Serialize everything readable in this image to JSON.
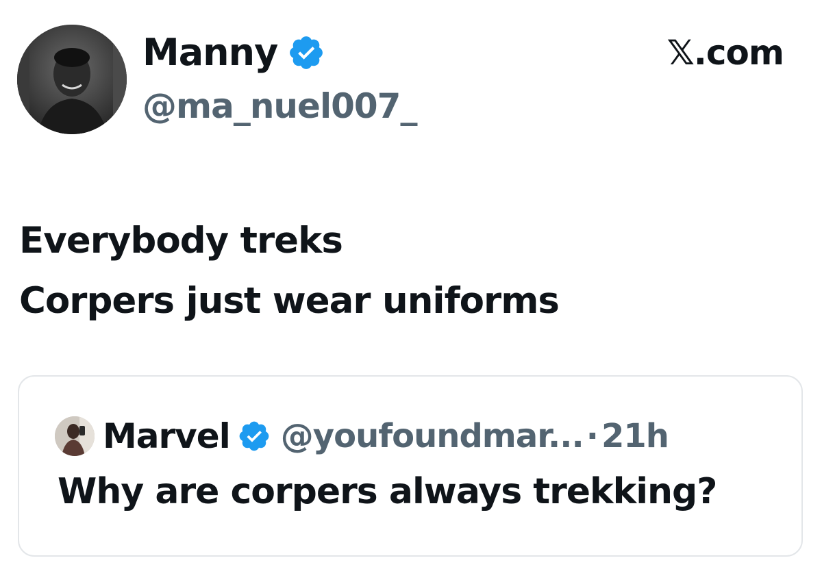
{
  "author": {
    "display_name": "Manny",
    "handle": "@ma_nuel007_",
    "avatar_icon": "profile-photo",
    "verified_icon": "verified-badge-icon",
    "verified_color": "#1d9bf0"
  },
  "source": {
    "label": "𝕏.com"
  },
  "tweet": {
    "lines": [
      "Everybody treks",
      "Corpers just wear uniforms"
    ]
  },
  "quote": {
    "display_name": "Marvel",
    "handle": "@youfoundmar...",
    "separator": "·",
    "time": "21h",
    "text": "Why are corpers always trekking?",
    "avatar_icon": "profile-photo",
    "verified_icon": "verified-badge-icon"
  },
  "colors": {
    "text_primary": "#0f1419",
    "text_secondary": "#536471",
    "card_border": "#e3e6e9"
  }
}
